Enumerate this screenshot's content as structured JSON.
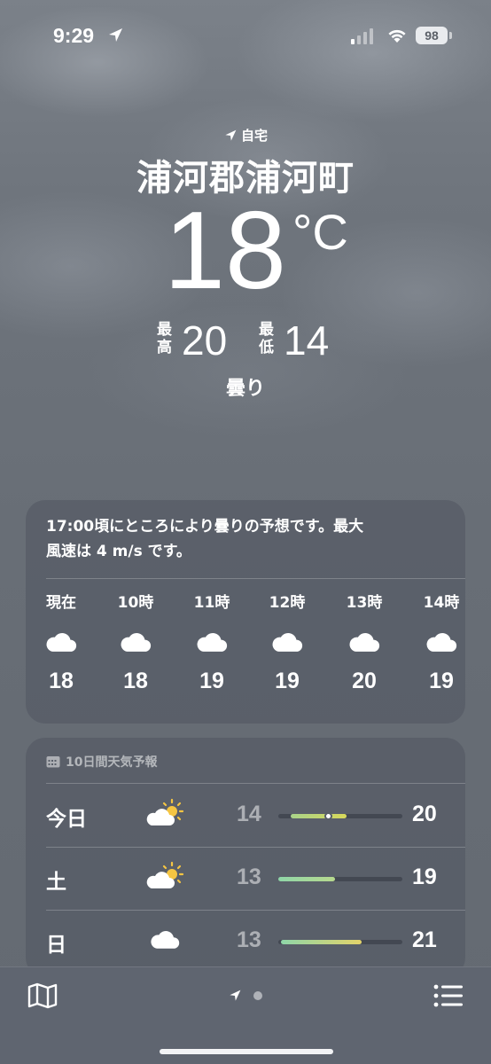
{
  "status_bar": {
    "time": "9:29",
    "battery": "98"
  },
  "location": {
    "home_label": "自宅",
    "city": "浦河郡浦河町",
    "temperature": "18",
    "unit": "°C",
    "high_label": "最高",
    "high": "20",
    "low_label": "最低",
    "low": "14",
    "condition": "曇り"
  },
  "hourly": {
    "summary_line1": "17:00頃にところにより曇りの予想です。最大",
    "summary_line2": "風速は 4 m/s です。",
    "items": [
      {
        "label": "現在",
        "icon": "cloud-icon",
        "temp": "18"
      },
      {
        "label": "10時",
        "icon": "cloud-icon",
        "temp": "18"
      },
      {
        "label": "11時",
        "icon": "cloud-icon",
        "temp": "19"
      },
      {
        "label": "12時",
        "icon": "cloud-icon",
        "temp": "19"
      },
      {
        "label": "13時",
        "icon": "cloud-icon",
        "temp": "20"
      },
      {
        "label": "14時",
        "icon": "cloud-icon",
        "temp": "19"
      }
    ]
  },
  "daily": {
    "title": "10日間天気予報",
    "days": [
      {
        "name": "今日",
        "icon": "partly-sunny-icon",
        "low": "14",
        "high": "20",
        "range_start": 0.1,
        "range_end": 0.55,
        "current_pos": 0.4,
        "colors": [
          "#a9d38a",
          "#d8d85a"
        ]
      },
      {
        "name": "土",
        "icon": "partly-sunny-icon",
        "low": "13",
        "high": "19",
        "range_start": 0.0,
        "range_end": 0.46,
        "colors": [
          "#8fd6a8",
          "#b7d98e"
        ]
      },
      {
        "name": "日",
        "icon": "cloud-icon",
        "low": "13",
        "high": "21",
        "range_start": 0.02,
        "range_end": 0.67,
        "colors": [
          "#8fd6a8",
          "#e3d36a"
        ]
      }
    ]
  }
}
